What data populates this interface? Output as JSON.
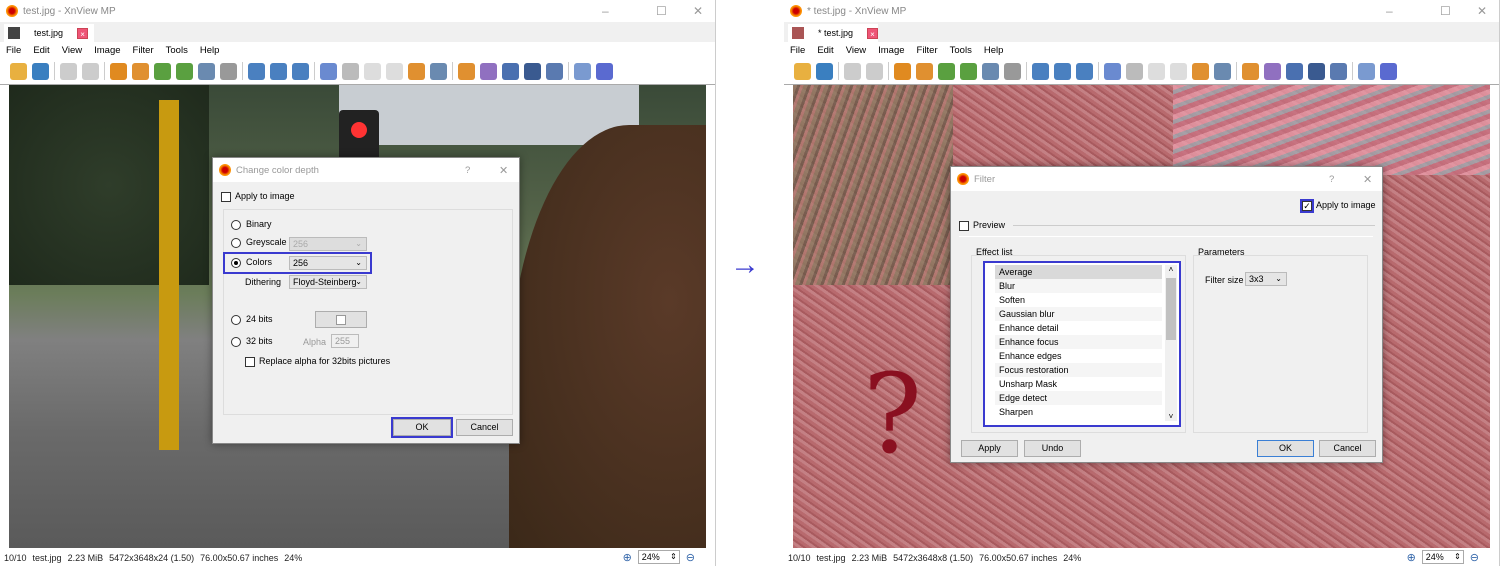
{
  "left_window": {
    "title": "test.jpg - XnView MP",
    "tab": "test.jpg",
    "tab_close": "×",
    "menu": [
      "File",
      "Edit",
      "View",
      "Image",
      "Filter",
      "Tools",
      "Help"
    ],
    "status": {
      "index": "10/10",
      "file": "test.jpg",
      "size": "2.23 MiB",
      "dims": "5472x3648x24 (1.50)",
      "inches": "76.00x50.67 inches",
      "zoom": "24%"
    },
    "zoom_value": "24%",
    "dialog": {
      "title": "Change color depth",
      "help": "?",
      "close": "✕",
      "apply_to_image": "Apply to image",
      "binary": "Binary",
      "greyscale": "Greyscale",
      "greyscale_value": "256",
      "colors": "Colors",
      "colors_value": "256",
      "dithering": "Dithering",
      "dithering_value": "Floyd-Steinberg",
      "bits24": "24 bits",
      "bits32": "32 bits",
      "alpha": "Alpha",
      "alpha_value": "255",
      "replace_alpha": "Replace alpha for 32bits pictures",
      "ok": "OK",
      "cancel": "Cancel"
    }
  },
  "right_window": {
    "title": "* test.jpg - XnView MP",
    "tab": "* test.jpg",
    "tab_close": "×",
    "menu": [
      "File",
      "Edit",
      "View",
      "Image",
      "Filter",
      "Tools",
      "Help"
    ],
    "status": {
      "index": "10/10",
      "file": "test.jpg",
      "size": "2.23 MiB",
      "dims": "5472x3648x8 (1.50)",
      "inches": "76.00x50.67 inches",
      "zoom": "24%"
    },
    "zoom_value": "24%",
    "question_mark": "?",
    "dialog": {
      "title": "Filter",
      "help": "?",
      "close": "✕",
      "apply_to_image": "Apply to image",
      "preview": "Preview",
      "effect_list_label": "Effect list",
      "effects": [
        "Average",
        "Blur",
        "Soften",
        "Gaussian blur",
        "Enhance detail",
        "Enhance focus",
        "Enhance edges",
        "Focus restoration",
        "Unsharp Mask",
        "Edge detect",
        "Sharpen"
      ],
      "parameters_label": "Parameters",
      "filter_size_label": "Filter size",
      "filter_size_value": "3x3",
      "apply": "Apply",
      "undo": "Undo",
      "ok": "OK",
      "cancel": "Cancel"
    }
  },
  "arrow": "→",
  "toolbar_icons": [
    {
      "name": "browser-icon",
      "color": "#e8b040"
    },
    {
      "name": "save-icon",
      "color": "#3a7fc0"
    },
    "sep",
    {
      "name": "undo-icon",
      "color": "#ccc"
    },
    {
      "name": "redo-icon",
      "color": "#ccc"
    },
    "sep",
    {
      "name": "crop-icon",
      "color": "#e08a20"
    },
    {
      "name": "resize-icon",
      "color": "#e09030"
    },
    {
      "name": "rotate-left-icon",
      "color": "#5aa040"
    },
    {
      "name": "rotate-right-icon",
      "color": "#5aa040"
    },
    {
      "name": "adjust-colors-icon",
      "color": "#6a8ab0"
    },
    {
      "name": "histogram-icon",
      "color": "#999"
    },
    "sep",
    {
      "name": "zoom-in-icon",
      "color": "#4a80c0"
    },
    {
      "name": "zoom-1to1-icon",
      "color": "#4a80c0"
    },
    {
      "name": "zoom-out-icon",
      "color": "#4a80c0"
    },
    "sep",
    {
      "name": "previous-icon",
      "color": "#6a8ad0"
    },
    {
      "name": "next-icon",
      "color": "#bbb"
    },
    {
      "name": "first-icon",
      "color": "#ddd"
    },
    {
      "name": "last-icon",
      "color": "#ddd"
    },
    {
      "name": "slideshow-icon",
      "color": "#e09030"
    },
    {
      "name": "info-icon",
      "color": "#6a8ab0"
    },
    "sep",
    {
      "name": "fullscreen-icon",
      "color": "#e09030"
    },
    {
      "name": "edit-text-icon",
      "color": "#9070c0"
    },
    {
      "name": "print-icon",
      "color": "#4a70b0"
    },
    {
      "name": "scan-icon",
      "color": "#3a5a90"
    },
    {
      "name": "capture-icon",
      "color": "#5a7ab0"
    },
    "sep",
    {
      "name": "settings-icon",
      "color": "#7a9ad0"
    },
    {
      "name": "help-icon",
      "color": "#5a6ad0"
    }
  ],
  "colors": {
    "highlight": "#3a3acf",
    "accent": "#3a7fd5"
  }
}
